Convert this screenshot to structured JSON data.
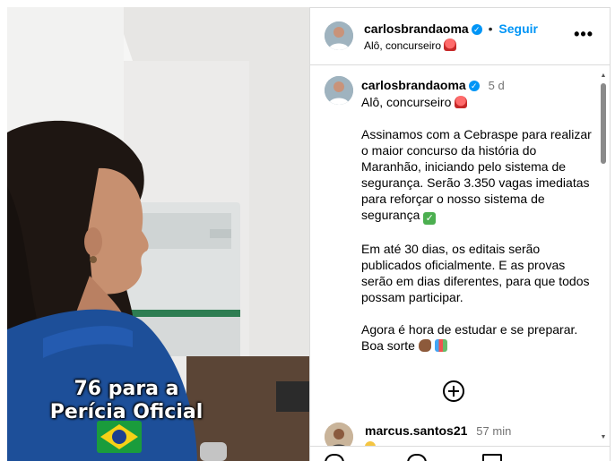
{
  "media": {
    "overlay_line1": "76 para a",
    "overlay_line2": "Perícia Oficial"
  },
  "header": {
    "username": "carlosbrandaoma",
    "separator": "•",
    "follow_label": "Seguir",
    "subtitle": "Alô, concurseiro",
    "more_icon": "more-horizontal-icon"
  },
  "caption": {
    "username": "carlosbrandaoma",
    "time": "5 d",
    "greeting": "Alô, concurseiro",
    "paragraph1": "Assinamos com a Cebraspe para realizar o maior concurso da história do Maranhão, iniciando pelo sistema de segurança. Serão 3.350 vagas imediatas para reforçar o nosso sistema de segurança",
    "paragraph2": "Em até 30 dias, os editais serão publicados oficialmente. E as provas serão em dias diferentes, para que todos possam participar.",
    "paragraph3_line1": "Agora é hora de estudar e se preparar.",
    "paragraph3_line2": "Boa sorte"
  },
  "comment": {
    "username": "marcus.santos21",
    "time": "57 min"
  },
  "colors": {
    "link_blue": "#0095f6",
    "border": "#dbdbdb",
    "muted": "#737373"
  }
}
